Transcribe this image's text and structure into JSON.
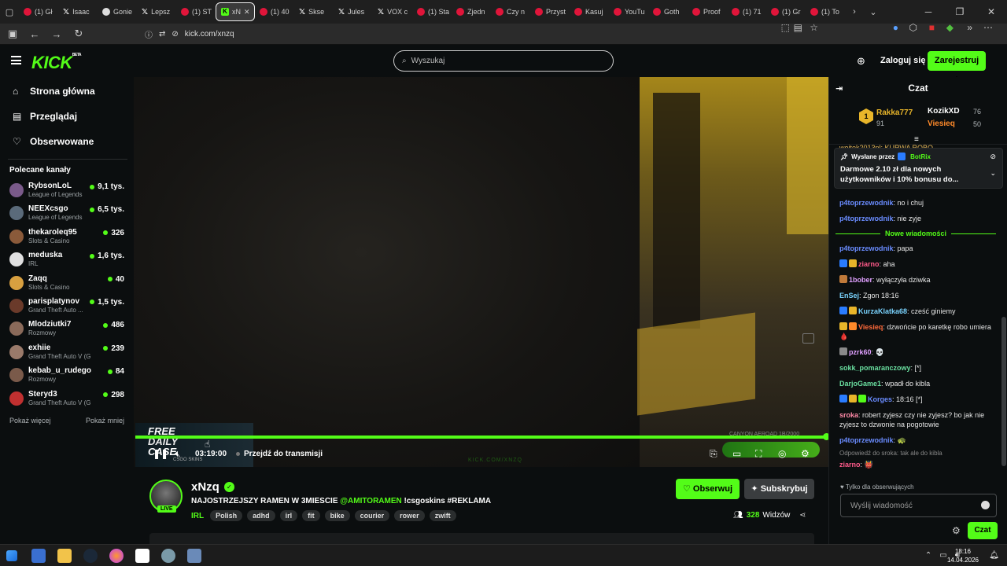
{
  "browser": {
    "tabs": [
      {
        "label": "(1) Gł",
        "icon": "yt-icon",
        "kind": "red"
      },
      {
        "label": "Isaac",
        "icon": "x-icon",
        "kind": "x"
      },
      {
        "label": "Gonie",
        "icon": "globe-icon",
        "kind": "gray"
      },
      {
        "label": "Lepsz",
        "icon": "x-icon",
        "kind": "x"
      },
      {
        "label": "(1) ST",
        "icon": "yt-icon",
        "kind": "red"
      },
      {
        "label": "xN",
        "icon": "kick-icon",
        "kind": "green",
        "active": true
      },
      {
        "label": "(1) 40",
        "icon": "yt-icon",
        "kind": "red"
      },
      {
        "label": "Skse",
        "icon": "x-icon",
        "kind": "x"
      },
      {
        "label": "Jules",
        "icon": "x-icon",
        "kind": "x"
      },
      {
        "label": "VOX c",
        "icon": "x-icon",
        "kind": "x"
      },
      {
        "label": "(1) Sta",
        "icon": "yt-icon",
        "kind": "red"
      },
      {
        "label": "Zjedn",
        "icon": "yt-icon",
        "kind": "red"
      },
      {
        "label": "Czy n",
        "icon": "yt-icon",
        "kind": "red"
      },
      {
        "label": "Przyst",
        "icon": "yt-icon",
        "kind": "red"
      },
      {
        "label": "Kasuj",
        "icon": "yt-icon",
        "kind": "red"
      },
      {
        "label": "YouTu",
        "icon": "yt-icon",
        "kind": "red"
      },
      {
        "label": "Goth",
        "icon": "yt-icon",
        "kind": "red"
      },
      {
        "label": "Proof",
        "icon": "yt-icon",
        "kind": "red"
      },
      {
        "label": "(1) 71",
        "icon": "yt-icon",
        "kind": "red"
      },
      {
        "label": "(1) Gr",
        "icon": "yt-icon",
        "kind": "red"
      },
      {
        "label": "(1) To",
        "icon": "yt-icon",
        "kind": "red"
      }
    ],
    "url": "kick.com/xnzq"
  },
  "topnav": {
    "logo": "KICK",
    "logo_badge": "BETA",
    "search_placeholder": "Wyszukaj",
    "login": "Zaloguj się",
    "signup": "Zarejestruj się"
  },
  "sidebar": {
    "nav": [
      {
        "label": "Strona główna",
        "icon": "home-icon"
      },
      {
        "label": "Przeglądaj",
        "icon": "browse-icon"
      },
      {
        "label": "Obserwowane",
        "icon": "heart-icon"
      }
    ],
    "recommended_title": "Polecane kanały",
    "channels": [
      {
        "name": "RybsonLoL",
        "category": "League of Legends",
        "viewers": "9,1 tys."
      },
      {
        "name": "NEEXcsgo",
        "category": "League of Legends",
        "viewers": "6,5 tys."
      },
      {
        "name": "thekaroleq95",
        "category": "Slots & Casino",
        "viewers": "326"
      },
      {
        "name": "meduska",
        "category": "IRL",
        "viewers": "1,6 tys."
      },
      {
        "name": "Zaqq",
        "category": "Slots & Casino",
        "viewers": "40"
      },
      {
        "name": "parisplatynov",
        "category": "Grand Theft Auto ...",
        "viewers": "1,5 tys."
      },
      {
        "name": "Mlodziutki7",
        "category": "Rozmowy",
        "viewers": "486"
      },
      {
        "name": "exhiie",
        "category": "Grand Theft Auto V (G...",
        "viewers": "239"
      },
      {
        "name": "kebab_u_rudego",
        "category": "Rozmowy",
        "viewers": "84"
      },
      {
        "name": "Steryd3",
        "category": "Grand Theft Auto V (G...",
        "viewers": "298"
      }
    ],
    "show_more": "Pokaż więcej",
    "show_less": "Pokaż mniej"
  },
  "player": {
    "time": "03:19:00",
    "jump_live": "Przejdź do transmisji",
    "progress": 1.0,
    "promo_line1": "FREE",
    "promo_line2": "DAILY",
    "promo_line3": "CASE",
    "promo_sub": "CSGO SKINS",
    "watermark": "KICK.COM/XNZQ",
    "overlay_text": "CANYON AEROAD 1B/2000"
  },
  "stream": {
    "streamer": "xNzq",
    "live_label": "LIVE",
    "title_prefix": "NAJOSTRZEJSZY RAMEN W 3MIESCIE ",
    "title_mention": "@AMITORAMEN",
    "title_suffix": " !csgoskins #REKLAMA",
    "category": "IRL",
    "tags": [
      "Polish",
      "adhd",
      "irl",
      "fit",
      "bike",
      "courier",
      "rower",
      "zwift"
    ],
    "follow": "Obserwuj",
    "subscribe": "Subskrybuj",
    "viewers": "328",
    "viewers_label": "Widzów"
  },
  "chat": {
    "title": "Czat",
    "leaderboard": [
      {
        "rank": "1",
        "name": "Rakka777",
        "value": "91"
      },
      {
        "name": "KozikXD",
        "value": "76"
      },
      {
        "name": "Viesieq",
        "value": "50"
      }
    ],
    "pinned_by": "Wysłane przez",
    "pinned_user": "BotRix",
    "pinned_text": "Darmowe 2.10 zł dla nowych użytkowników i 10% bonusu do...",
    "partial_top": "wojtek2013pl: KURWA ROBO",
    "messages_before": [
      {
        "user": "p4toprzewodnik",
        "text": ": no i chuj",
        "color": "#6a8cff"
      },
      {
        "user": "p4toprzewodnik",
        "text": ": nie zyje",
        "color": "#6a8cff"
      }
    ],
    "new_messages_label": "Nowe wiadomości",
    "messages": [
      {
        "user": "p4toprzewodnik",
        "text": ": papa",
        "color": "#6a8cff",
        "badges": []
      },
      {
        "user": "ziarno",
        "text": ": aha",
        "color": "#ff5a8a",
        "badges": [
          "#2a7cff",
          "#e8b52a"
        ]
      },
      {
        "user": "1bober",
        "text": ": wyłączyła dziwka",
        "color": "#e0a0ff",
        "badges": [
          "#c07a3a"
        ]
      },
      {
        "user": "EnSej",
        "text": ": Zgon 18:16",
        "color": "#7ad4ff",
        "badges": []
      },
      {
        "user": "KurzaKlatka68",
        "text": ": cześć giniemy",
        "color": "#7ad4ff",
        "badges": [
          "#2a7cff",
          "#e8b52a"
        ]
      },
      {
        "user": "Viesieq",
        "text": ": dzwońcie po karetkę robo umiera 🩸",
        "color": "#ff6a3a",
        "badges": [
          "#e8b52a",
          "#ff8a2a"
        ]
      },
      {
        "user": "pzrk60",
        "text": ": 💀",
        "color": "#e0a0ff",
        "badges": [
          "#8a8a8a"
        ]
      },
      {
        "user": "sokk_pomaranczowy",
        "text": ": [*]",
        "color": "#6adfa0",
        "badges": []
      },
      {
        "user": "DarjoGame1",
        "text": ": wpadł do kibla",
        "color": "#6adfa0",
        "badges": []
      },
      {
        "user": "Korges",
        "text": ": 18:16 [*]",
        "color": "#6a8cff",
        "badges": [
          "#2a7cff",
          "#e8b52a",
          "#53fc18"
        ]
      },
      {
        "user": "sroka",
        "text": ": robert zyjesz czy nie zyjesz? bo jak nie zyjesz to dzwonie na pogotowie",
        "color": "#ff8aa8",
        "badges": []
      },
      {
        "user": "p4toprzewodnik",
        "text": ": 🐢",
        "color": "#6a8cff",
        "badges": []
      }
    ],
    "reply_note": "Odpowiedź do sroka: tak ale do kibla",
    "last_message": {
      "user": "ziarno",
      "text": ": 👹",
      "color": "#ff5a8a"
    },
    "followers_only": "Tylko dla obserwujących",
    "input_placeholder": "Wyślij wiadomość",
    "send": "Czat"
  },
  "taskbar": {
    "time": "18:16",
    "date": "14.04.2026"
  },
  "colors": {
    "accent": "#53fc18",
    "background": "#0b0e0f"
  }
}
